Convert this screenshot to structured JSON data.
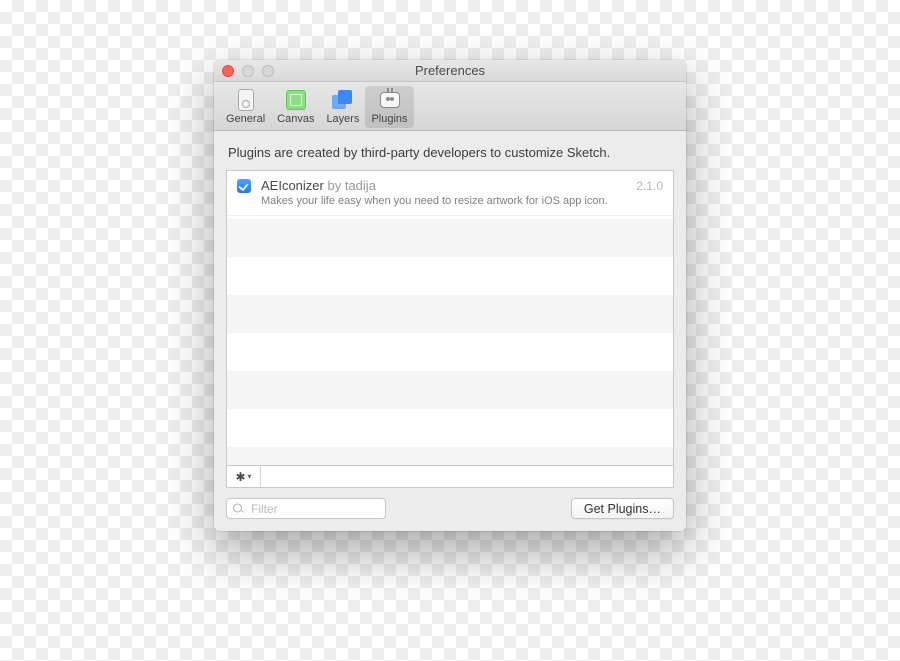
{
  "window": {
    "title": "Preferences"
  },
  "toolbar": {
    "items": [
      {
        "label": "General"
      },
      {
        "label": "Canvas"
      },
      {
        "label": "Layers"
      },
      {
        "label": "Plugins"
      }
    ]
  },
  "content": {
    "intro": "Plugins are created by third-party developers to customize Sketch."
  },
  "plugins": [
    {
      "name": "AEIconizer",
      "by_prefix": " by ",
      "author": "tadija",
      "version": "2.1.0",
      "description": "Makes your life easy when you need to resize artwork for iOS app icon."
    }
  ],
  "footer": {
    "search_placeholder": "Filter",
    "get_plugins": "Get Plugins…"
  }
}
